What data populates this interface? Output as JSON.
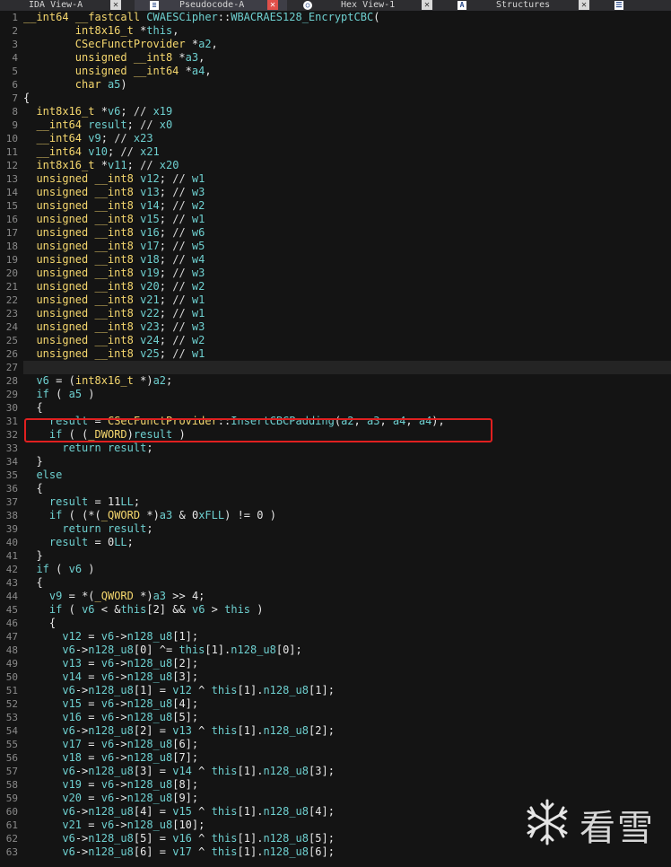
{
  "tabs": [
    {
      "label": "IDA View-A",
      "close": "close-icon",
      "active": false
    },
    {
      "label": "Pseudocode-A",
      "close": "close-icon",
      "active": true
    },
    {
      "label": "Hex View-1",
      "close": "close-icon",
      "active": false
    },
    {
      "label": "Structures",
      "close": "close-icon",
      "active": false
    }
  ],
  "watermark": {
    "text": "看雪"
  },
  "lines": [
    {
      "n": "1",
      "t": "__int64 __fastcall CWAESCipher::WBACRAES128_EncryptCBC("
    },
    {
      "n": "2",
      "t": "        int8x16_t *this,"
    },
    {
      "n": "3",
      "t": "        CSecFunctProvider *a2,"
    },
    {
      "n": "4",
      "t": "        unsigned __int8 *a3,"
    },
    {
      "n": "5",
      "t": "        unsigned __int64 *a4,"
    },
    {
      "n": "6",
      "t": "        char a5)"
    },
    {
      "n": "7",
      "t": "{"
    },
    {
      "n": "8",
      "t": "  int8x16_t *v6; // x19"
    },
    {
      "n": "9",
      "t": "  __int64 result; // x0"
    },
    {
      "n": "10",
      "t": "  __int64 v9; // x23"
    },
    {
      "n": "11",
      "t": "  __int64 v10; // x21"
    },
    {
      "n": "12",
      "t": "  int8x16_t *v11; // x20"
    },
    {
      "n": "13",
      "t": "  unsigned __int8 v12; // w1"
    },
    {
      "n": "14",
      "t": "  unsigned __int8 v13; // w3"
    },
    {
      "n": "15",
      "t": "  unsigned __int8 v14; // w2"
    },
    {
      "n": "16",
      "t": "  unsigned __int8 v15; // w1"
    },
    {
      "n": "17",
      "t": "  unsigned __int8 v16; // w6"
    },
    {
      "n": "18",
      "t": "  unsigned __int8 v17; // w5"
    },
    {
      "n": "19",
      "t": "  unsigned __int8 v18; // w4"
    },
    {
      "n": "20",
      "t": "  unsigned __int8 v19; // w3"
    },
    {
      "n": "21",
      "t": "  unsigned __int8 v20; // w2"
    },
    {
      "n": "22",
      "t": "  unsigned __int8 v21; // w1"
    },
    {
      "n": "23",
      "t": "  unsigned __int8 v22; // w1"
    },
    {
      "n": "24",
      "t": "  unsigned __int8 v23; // w3"
    },
    {
      "n": "25",
      "t": "  unsigned __int8 v24; // w2"
    },
    {
      "n": "26",
      "t": "  unsigned __int8 v25; // w1"
    },
    {
      "n": "27",
      "t": ""
    },
    {
      "n": "28",
      "t": "  v6 = (int8x16_t *)a2;"
    },
    {
      "n": "29",
      "t": "  if ( a5 )"
    },
    {
      "n": "30",
      "t": "  {"
    },
    {
      "n": "31",
      "t": "    result = CSecFunctProvider::InsertCBCPadding(a2, a3, a4, a4);"
    },
    {
      "n": "32",
      "t": "    if ( (_DWORD)result )"
    },
    {
      "n": "33",
      "t": "      return result;"
    },
    {
      "n": "34",
      "t": "  }"
    },
    {
      "n": "35",
      "t": "  else"
    },
    {
      "n": "36",
      "t": "  {"
    },
    {
      "n": "37",
      "t": "    result = 11LL;"
    },
    {
      "n": "38",
      "t": "    if ( (*(_QWORD *)a3 & 0xFLL) != 0 )"
    },
    {
      "n": "39",
      "t": "      return result;"
    },
    {
      "n": "40",
      "t": "    result = 0LL;"
    },
    {
      "n": "41",
      "t": "  }"
    },
    {
      "n": "42",
      "t": "  if ( v6 )"
    },
    {
      "n": "43",
      "t": "  {"
    },
    {
      "n": "44",
      "t": "    v9 = *(_QWORD *)a3 >> 4;"
    },
    {
      "n": "45",
      "t": "    if ( v6 < &this[2] && v6 > this )"
    },
    {
      "n": "46",
      "t": "    {"
    },
    {
      "n": "47",
      "t": "      v12 = v6->n128_u8[1];"
    },
    {
      "n": "48",
      "t": "      v6->n128_u8[0] ^= this[1].n128_u8[0];"
    },
    {
      "n": "49",
      "t": "      v13 = v6->n128_u8[2];"
    },
    {
      "n": "50",
      "t": "      v14 = v6->n128_u8[3];"
    },
    {
      "n": "51",
      "t": "      v6->n128_u8[1] = v12 ^ this[1].n128_u8[1];"
    },
    {
      "n": "52",
      "t": "      v15 = v6->n128_u8[4];"
    },
    {
      "n": "53",
      "t": "      v16 = v6->n128_u8[5];"
    },
    {
      "n": "54",
      "t": "      v6->n128_u8[2] = v13 ^ this[1].n128_u8[2];"
    },
    {
      "n": "55",
      "t": "      v17 = v6->n128_u8[6];"
    },
    {
      "n": "56",
      "t": "      v18 = v6->n128_u8[7];"
    },
    {
      "n": "57",
      "t": "      v6->n128_u8[3] = v14 ^ this[1].n128_u8[3];"
    },
    {
      "n": "58",
      "t": "      v19 = v6->n128_u8[8];"
    },
    {
      "n": "59",
      "t": "      v20 = v6->n128_u8[9];"
    },
    {
      "n": "60",
      "t": "      v6->n128_u8[4] = v15 ^ this[1].n128_u8[4];"
    },
    {
      "n": "61",
      "t": "      v21 = v6->n128_u8[10];"
    },
    {
      "n": "62",
      "t": "      v6->n128_u8[5] = v16 ^ this[1].n128_u8[5];"
    },
    {
      "n": "63",
      "t": "      v6->n128_u8[6] = v17 ^ this[1].n128_u8[6];"
    }
  ],
  "colors": {
    "background": "#141414",
    "keyword": "#6ed0d0",
    "type": "#f5d76e",
    "highlight_border": "#e02020"
  }
}
